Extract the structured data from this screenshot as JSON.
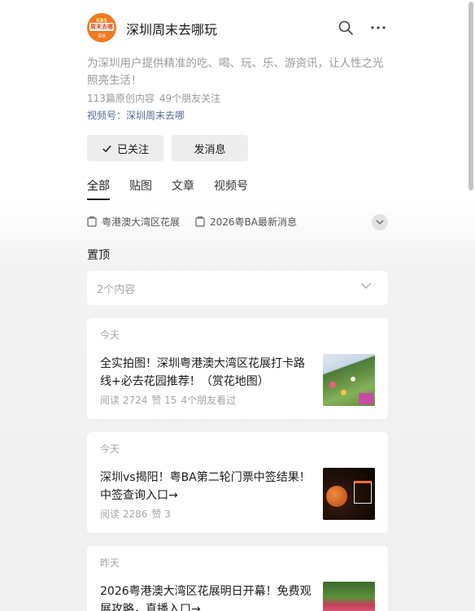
{
  "account": {
    "avatar_lines": [
      "KBS",
      "周末去哪",
      "深圳"
    ],
    "name": "深圳周末去哪玩",
    "description": "为深圳用户提供精准的吃、喝、玩、乐、游资讯，让人性之光照亮生活！",
    "original_count": "113篇原创内容",
    "friends_following": "49个朋友关注",
    "video_account": "视频号：深圳周末去哪"
  },
  "actions": {
    "followed_label": "已关注",
    "message_label": "发消息"
  },
  "tabs": [
    {
      "label": "全部",
      "active": true
    },
    {
      "label": "贴图",
      "active": false
    },
    {
      "label": "文章",
      "active": false
    },
    {
      "label": "视频号",
      "active": false
    }
  ],
  "collections": [
    "粤港澳大湾区花展",
    "2026粤BA最新消息"
  ],
  "pinned": {
    "title": "置顶",
    "summary": "2个内容"
  },
  "articles": [
    {
      "day": "今天",
      "title": "全实拍图！深圳粤港澳大湾区花展打卡路线+必去花园推荐！（赏花地图）",
      "reads": "阅读 2724",
      "likes": "赞 15",
      "friends": "4个朋友看过"
    },
    {
      "day": "今天",
      "title": "深圳vs揭阳！粤BA第二轮门票中签结果！中签查询入口→",
      "reads": "阅读 2286",
      "likes": "赞 3",
      "friends": ""
    },
    {
      "day": "昨天",
      "title": "2026粤港澳大湾区花展明日开幕！免费观展攻略，直播入口→",
      "reads": "",
      "likes": "",
      "friends": ""
    }
  ],
  "icons": {
    "search": "search-icon",
    "more": "more-icon",
    "check": "check-icon",
    "collection": "collection-icon",
    "chevron": "chevron-down-icon"
  },
  "colors": {
    "link": "#576b95",
    "avatar": "#f07a22",
    "muted": "#9a9a9a"
  }
}
